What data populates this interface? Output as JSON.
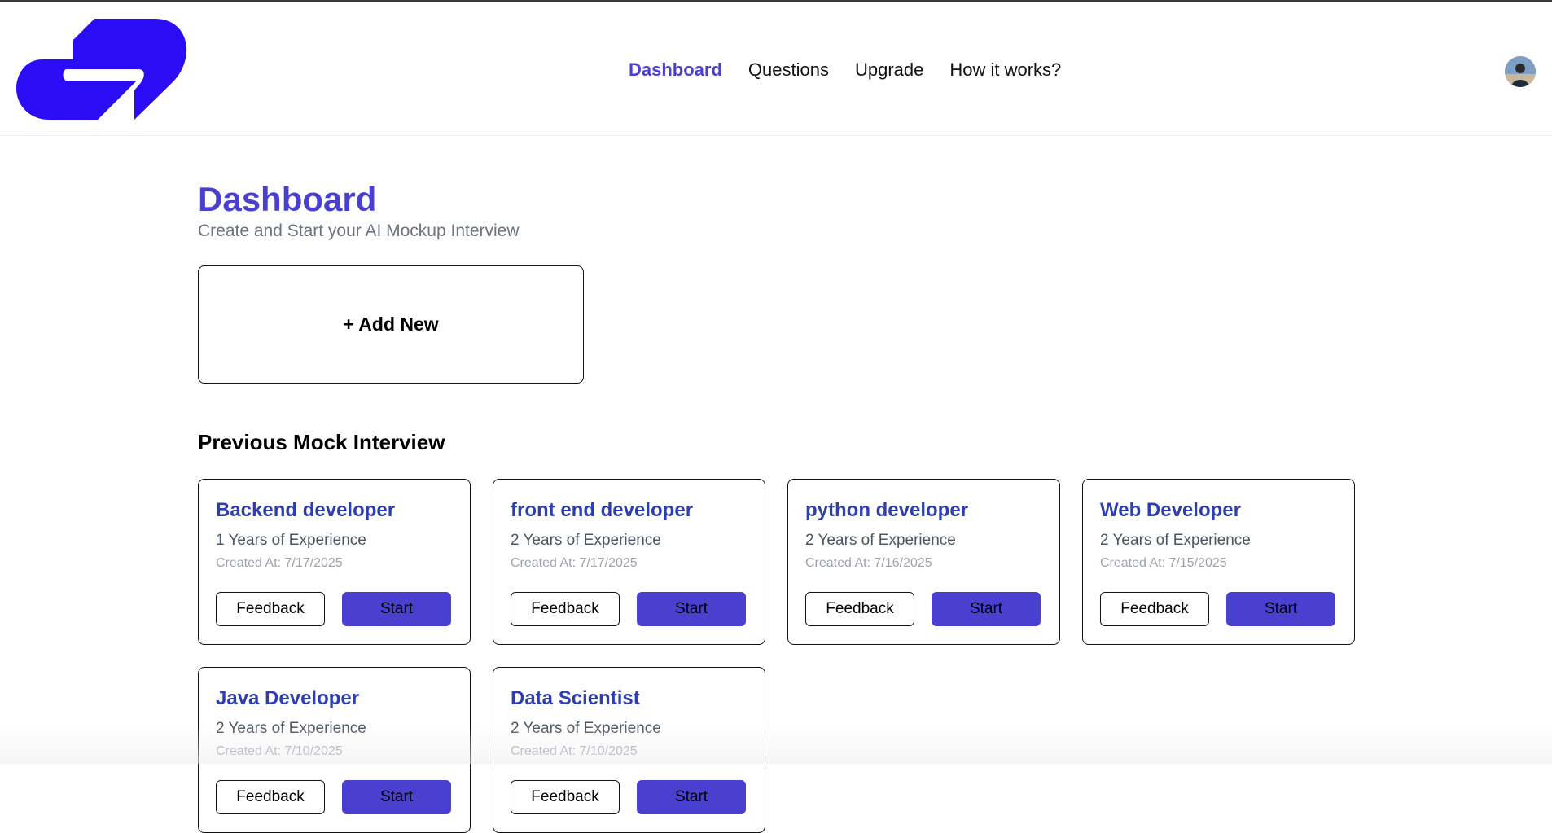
{
  "nav": {
    "items": [
      {
        "label": "Dashboard",
        "active": true
      },
      {
        "label": "Questions",
        "active": false
      },
      {
        "label": "Upgrade",
        "active": false
      },
      {
        "label": "How it works?",
        "active": false
      }
    ]
  },
  "colors": {
    "brand": "#2a0cf5",
    "accent": "#4a40cf",
    "card_title": "#2d3fb0"
  },
  "page": {
    "title": "Dashboard",
    "subtitle": "Create and Start your AI Mockup Interview",
    "add_new_label": "+ Add New",
    "section_title": "Previous Mock Interview"
  },
  "interviews": [
    {
      "role": "Backend developer",
      "experience": "1 Years of Experience",
      "created": "Created At: 7/17/2025",
      "feedback_label": "Feedback",
      "start_label": "Start"
    },
    {
      "role": "front end developer",
      "experience": "2 Years of Experience",
      "created": "Created At: 7/17/2025",
      "feedback_label": "Feedback",
      "start_label": "Start"
    },
    {
      "role": "python developer",
      "experience": "2 Years of Experience",
      "created": "Created At: 7/16/2025",
      "feedback_label": "Feedback",
      "start_label": "Start"
    },
    {
      "role": "Web Developer",
      "experience": "2 Years of Experience",
      "created": "Created At: 7/15/2025",
      "feedback_label": "Feedback",
      "start_label": "Start"
    },
    {
      "role": "Java Developer",
      "experience": "2 Years of Experience",
      "created": "Created At: 7/10/2025",
      "feedback_label": "Feedback",
      "start_label": "Start"
    },
    {
      "role": "Data Scientist",
      "experience": "2 Years of Experience",
      "created": "Created At: 7/10/2025",
      "feedback_label": "Feedback",
      "start_label": "Start"
    }
  ]
}
